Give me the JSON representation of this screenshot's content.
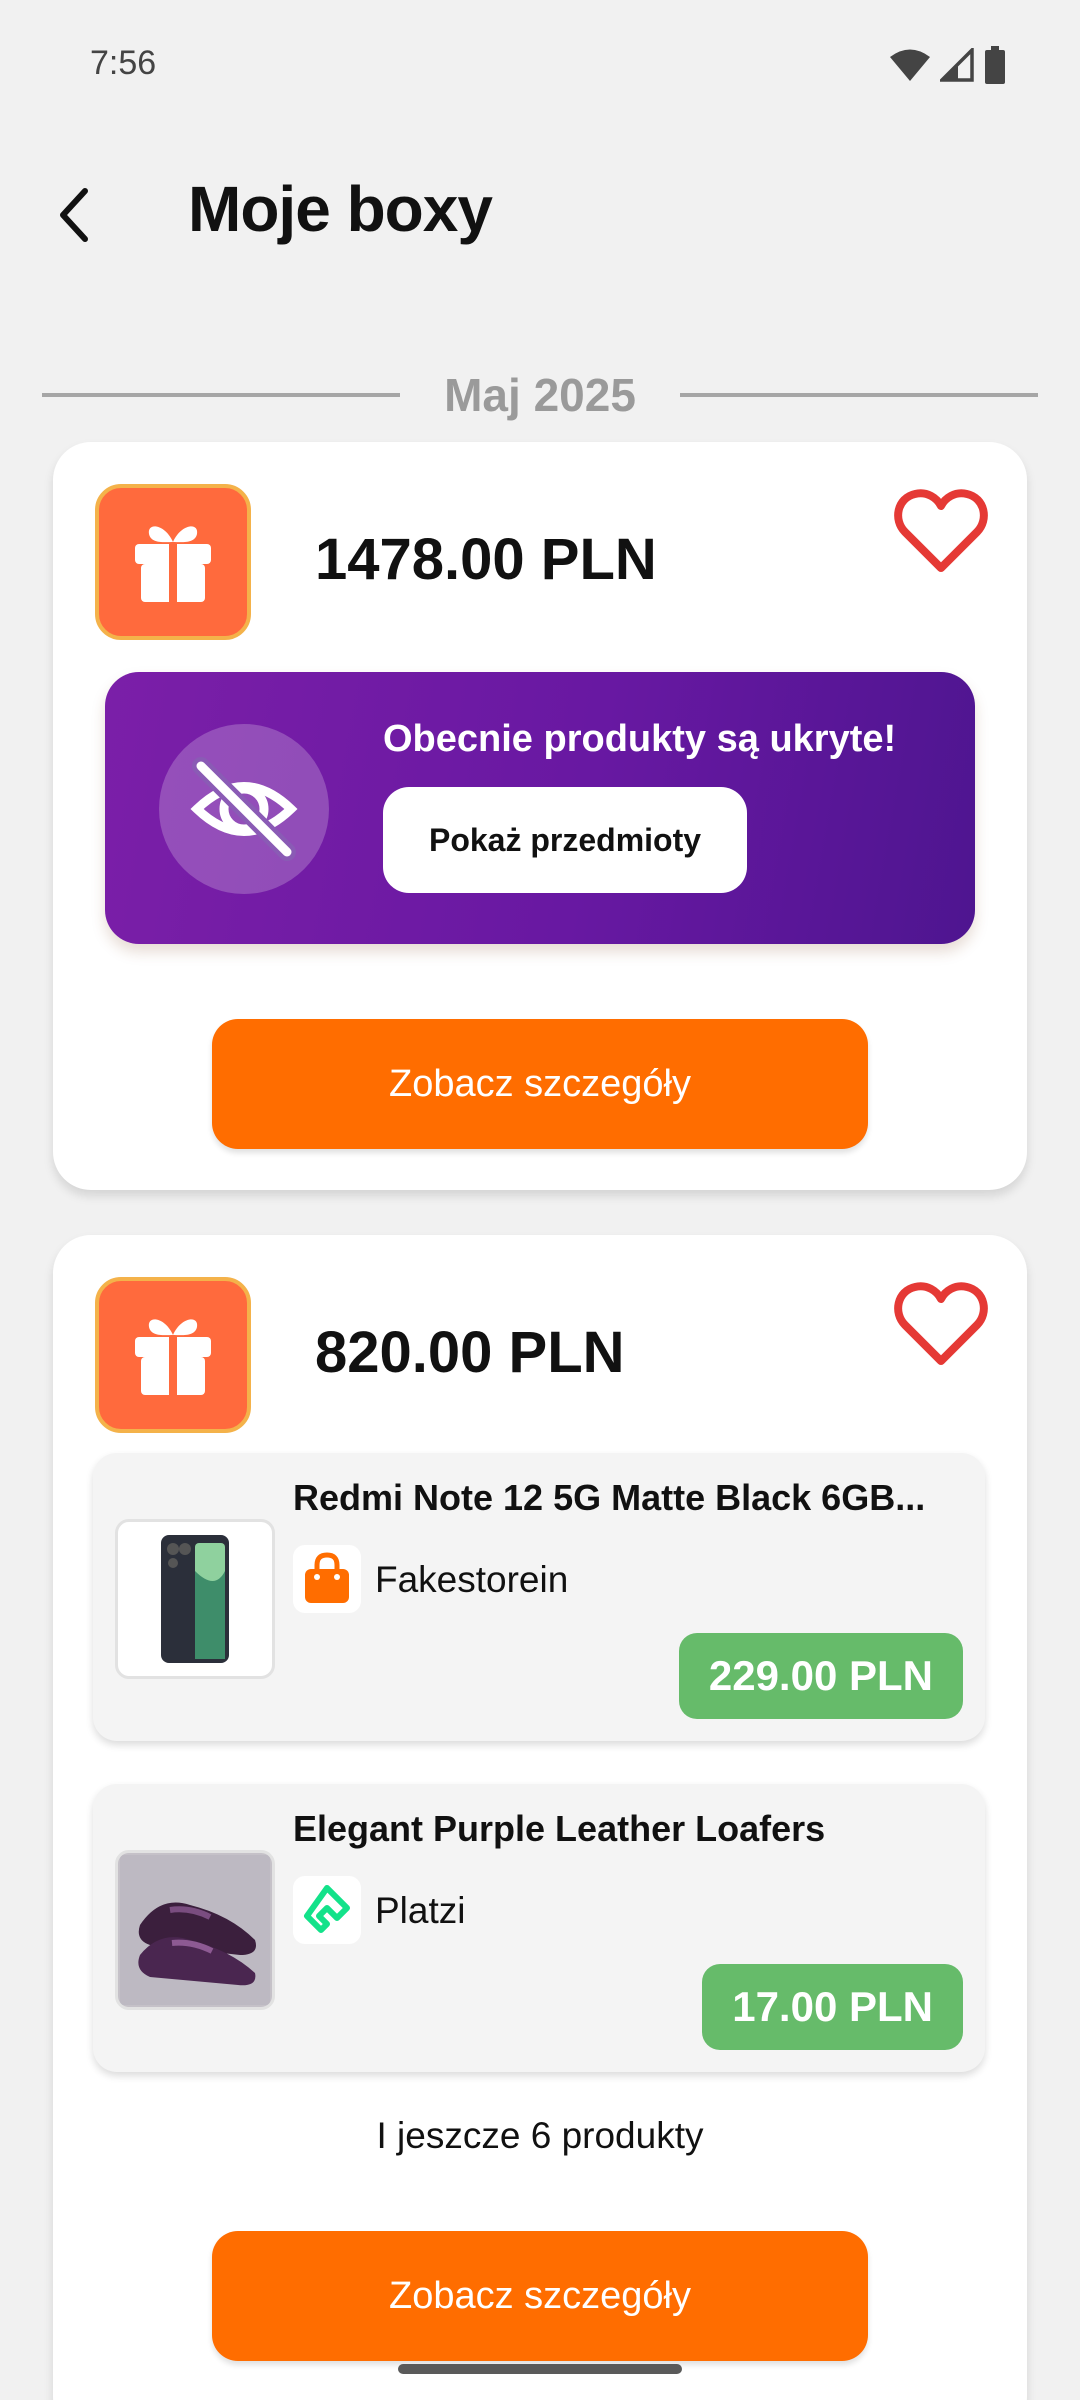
{
  "status_bar": {
    "time": "7:56"
  },
  "header": {
    "title": "Moje boxy"
  },
  "month_label": "Maj 2025",
  "boxes": [
    {
      "price": "1478.00 PLN",
      "hidden_banner": {
        "message": "Obecnie produkty są ukryte!",
        "button_label": "Pokaż przedmioty"
      },
      "details_label": "Zobacz szczegóły"
    },
    {
      "price": "820.00 PLN",
      "products": [
        {
          "name": "Redmi Note 12 5G Matte Black 6GB...",
          "store": "Fakestorein",
          "price": "229.00 PLN"
        },
        {
          "name": "Elegant Purple Leather Loafers",
          "store": "Platzi",
          "price": "17.00 PLN"
        }
      ],
      "more_text": "I jeszcze 6 produkty",
      "details_label": "Zobacz szczegóły"
    }
  ],
  "colors": {
    "accent_orange": "#ff6d00",
    "gift_bg": "#ff6a3d",
    "heart": "#e53935",
    "price_badge": "#66bb6a",
    "banner_purple": "#6818a2"
  }
}
